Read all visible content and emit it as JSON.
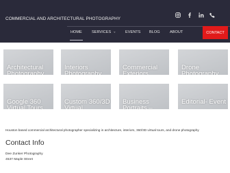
{
  "header": {
    "brand": "COMMERCIAL AND ARCHITECTURAL PHOTOGRAPHY",
    "social": [
      "instagram-icon",
      "facebook-icon",
      "linkedin-icon",
      "phone-icon"
    ]
  },
  "nav": {
    "items": [
      {
        "label": "HOME",
        "active": true
      },
      {
        "label": "SERVICES",
        "has_dropdown": true
      },
      {
        "label": "EVENTS"
      },
      {
        "label": "BLOG"
      },
      {
        "label": "ABOUT"
      }
    ],
    "contact_label": "CONTACT",
    "contact_color": "#e11a1a"
  },
  "tiles": [
    "Architectural Photography",
    "Interiors Photography",
    "Commercial Exteriors",
    "Drone Photography",
    "Google 360 Virtual Tours",
    "Custom 360/3D Virtual",
    "Business Portraits –",
    "Editorial- Event"
  ],
  "tagline": "Houston based commercial architectural photographer specializing in architecture, interiors, 360/3D virtual tours, and drone photography",
  "contact": {
    "heading": "Contact Info",
    "lines": [
      "Dee Zunker Photography",
      "4537 Maple Street"
    ]
  },
  "colors": {
    "header_bg": "#2a2a3a",
    "tile_bg": "#c8cbcf"
  }
}
